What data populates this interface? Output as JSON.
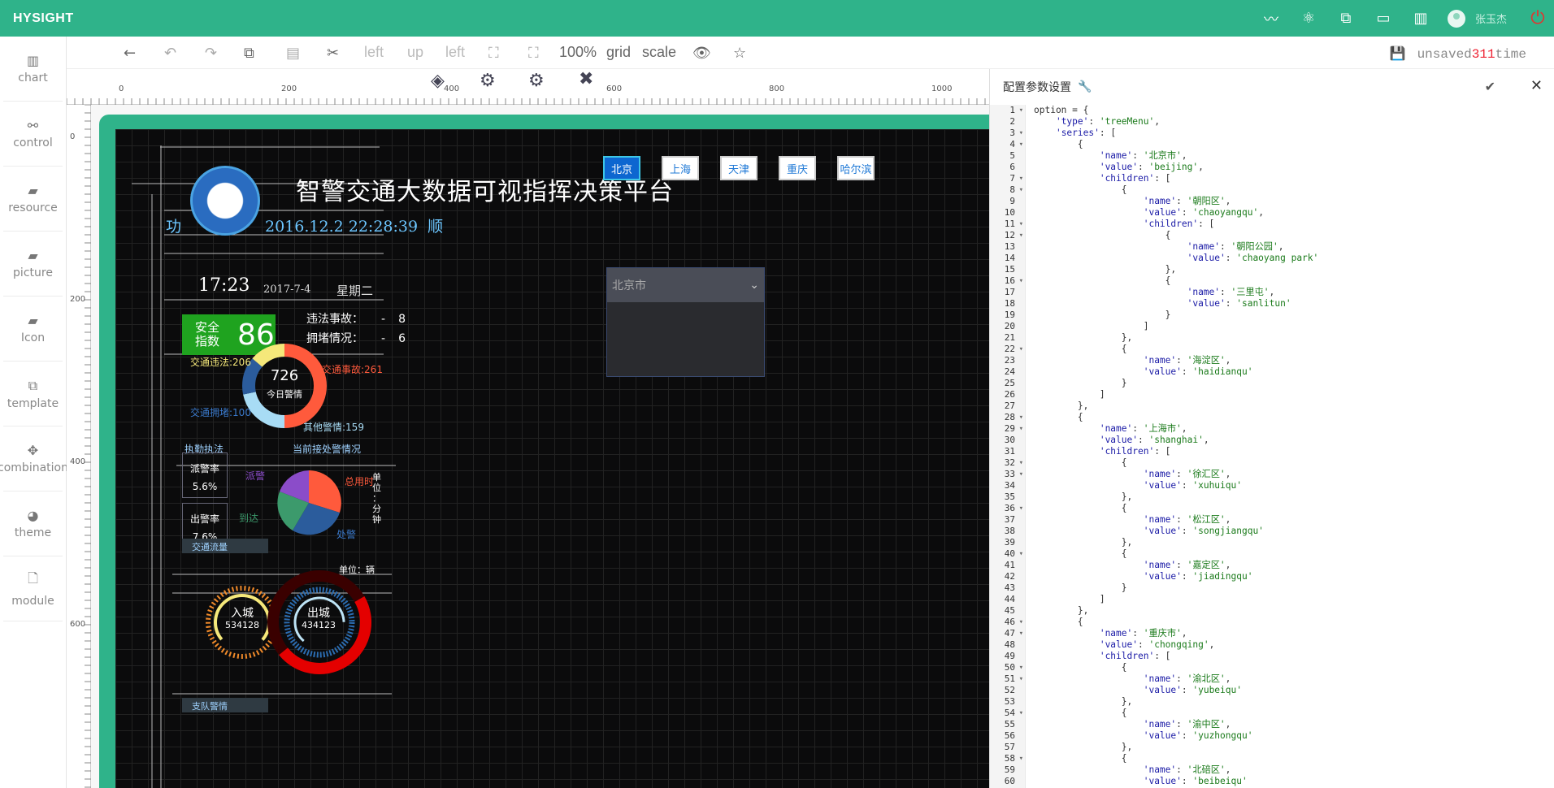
{
  "app": {
    "brand": "HYSIGHT",
    "user": "张玉杰"
  },
  "topbar_icons": [
    "chart-line-icon",
    "atom-icon",
    "share-icon",
    "monitor-icon",
    "bar-chart-icon"
  ],
  "sidebar": {
    "items": [
      {
        "label": "chart",
        "icon": "bar-chart-icon"
      },
      {
        "label": "control",
        "icon": "link-icon"
      },
      {
        "label": "resource",
        "icon": "book-icon"
      },
      {
        "label": "picture",
        "icon": "book-icon"
      },
      {
        "label": "Icon",
        "icon": "book-icon"
      },
      {
        "label": "template",
        "icon": "template-icon"
      },
      {
        "label": "combination",
        "icon": "combination-icon"
      },
      {
        "label": "theme",
        "icon": "pie-icon"
      },
      {
        "label": "module",
        "icon": "file-icon"
      }
    ]
  },
  "toolbar": {
    "left1": "left",
    "up": "up",
    "left2": "left",
    "zoom": "100%",
    "grid": "grid",
    "scale": "scale",
    "save_prefix": "unsaved",
    "save_count": "311",
    "save_suffix": "time"
  },
  "ruler": {
    "top_labels": [
      "0",
      "200",
      "400",
      "600",
      "800",
      "1000"
    ],
    "left_labels": [
      "0",
      "200",
      "400",
      "600"
    ]
  },
  "dashboard": {
    "title": "智警交通大数据可视指挥决策平台",
    "datetime_prefix": "功",
    "datetime": "2016.12.2  22:28:39",
    "datetime_suffix": "顺",
    "clock": "17:23",
    "date": "2017-7-4",
    "weekday": "星期二",
    "safety_label": "安全指数",
    "safety_value": "86",
    "stats": [
      {
        "label": "违法事故：",
        "dash": "-",
        "value": "8"
      },
      {
        "label": "拥堵情况：",
        "dash": "-",
        "value": "6"
      }
    ],
    "cities": [
      "北京",
      "上海",
      "天津",
      "重庆",
      "哈尔滨"
    ],
    "selected_city": "北京市",
    "donut": {
      "total": "726",
      "subtitle": "今日警情",
      "labels": {
        "a": "交通违法:206",
        "b": "交通事故:261",
        "c": "交通拥堵:100",
        "d": "其他警情:159"
      }
    },
    "section_titles": {
      "enforce": "执勤执法",
      "current": "当前接处警情况",
      "traffic": "交通流量",
      "branch": "支队警情"
    },
    "rates": [
      {
        "label": "派警率",
        "value": "5.6%"
      },
      {
        "label": "出警率",
        "value": "7.6%"
      }
    ],
    "pie_labels": {
      "dispatch": "派警",
      "time": "总用时",
      "arrive": "到达",
      "handle": "处警"
    },
    "pie_unit": [
      "单",
      "位",
      "：",
      "分",
      "钟"
    ],
    "flow_unit": "单位：辆",
    "gauges": [
      {
        "label": "入城",
        "value": "534128"
      },
      {
        "label": "出城",
        "value": "434123"
      }
    ]
  },
  "panel": {
    "title": "配置参数设置"
  },
  "chart_data": null,
  "code_lines": [
    "option = {",
    "    'type': 'treeMenu',",
    "    'series': [",
    "        {",
    "            'name': '北京市',",
    "            'value': 'beijing',",
    "            'children': [",
    "                {",
    "                    'name': '朝阳区',",
    "                    'value': 'chaoyangqu',",
    "                    'children': [",
    "                        {",
    "                            'name': '朝阳公园',",
    "                            'value': 'chaoyang park'",
    "                        },",
    "                        {",
    "                            'name': '三里屯',",
    "                            'value': 'sanlitun'",
    "                        }",
    "                    ]",
    "                },",
    "                {",
    "                    'name': '海淀区',",
    "                    'value': 'haidianqu'",
    "                }",
    "            ]",
    "        },",
    "        {",
    "            'name': '上海市',",
    "            'value': 'shanghai',",
    "            'children': [",
    "                {",
    "                    'name': '徐汇区',",
    "                    'value': 'xuhuiqu'",
    "                },",
    "                {",
    "                    'name': '松江区',",
    "                    'value': 'songjiangqu'",
    "                },",
    "                {",
    "                    'name': '嘉定区',",
    "                    'value': 'jiadingqu'",
    "                }",
    "            ]",
    "        },",
    "        {",
    "            'name': '重庆市',",
    "            'value': 'chongqing',",
    "            'children': [",
    "                {",
    "                    'name': '渝北区',",
    "                    'value': 'yubeiqu'",
    "                },",
    "                {",
    "                    'name': '渝中区',",
    "                    'value': 'yuzhongqu'",
    "                },",
    "                {",
    "                    'name': '北碚区',",
    "                    'value': 'beibeiqu'"
  ],
  "fold_lines": [
    1,
    3,
    4,
    7,
    8,
    11,
    12,
    16,
    22,
    28,
    29,
    32,
    33,
    36,
    40,
    46,
    47,
    50,
    51,
    54,
    58
  ],
  "colors": {
    "brand": "#2fb38a",
    "accent_red": "#e3342f",
    "safe_green": "#1fa31f"
  }
}
